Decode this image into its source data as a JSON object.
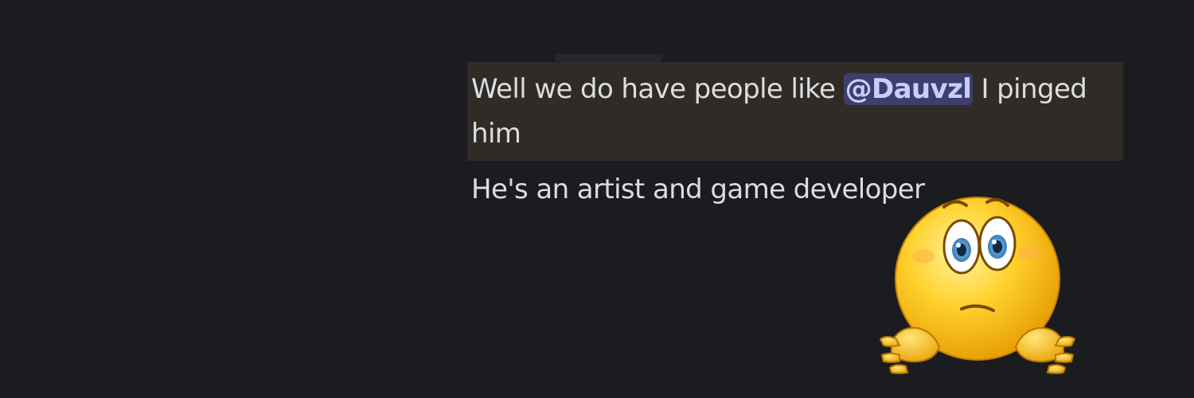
{
  "messages": [
    {
      "text_before": "Well we do have people like ",
      "mention": "@Dauvzl",
      "text_after": " I pinged him",
      "highlighted": true
    },
    {
      "text": "He's an artist and game developer",
      "highlighted": false
    }
  ],
  "sticker": {
    "icon": "worried-shrugging-emoji-icon"
  },
  "colors": {
    "background": "#1c1d21",
    "highlight": "#302b26",
    "mention_bg": "#3c3f6b",
    "mention_text": "#c9cdfb",
    "message_text": "#dbdee1"
  }
}
